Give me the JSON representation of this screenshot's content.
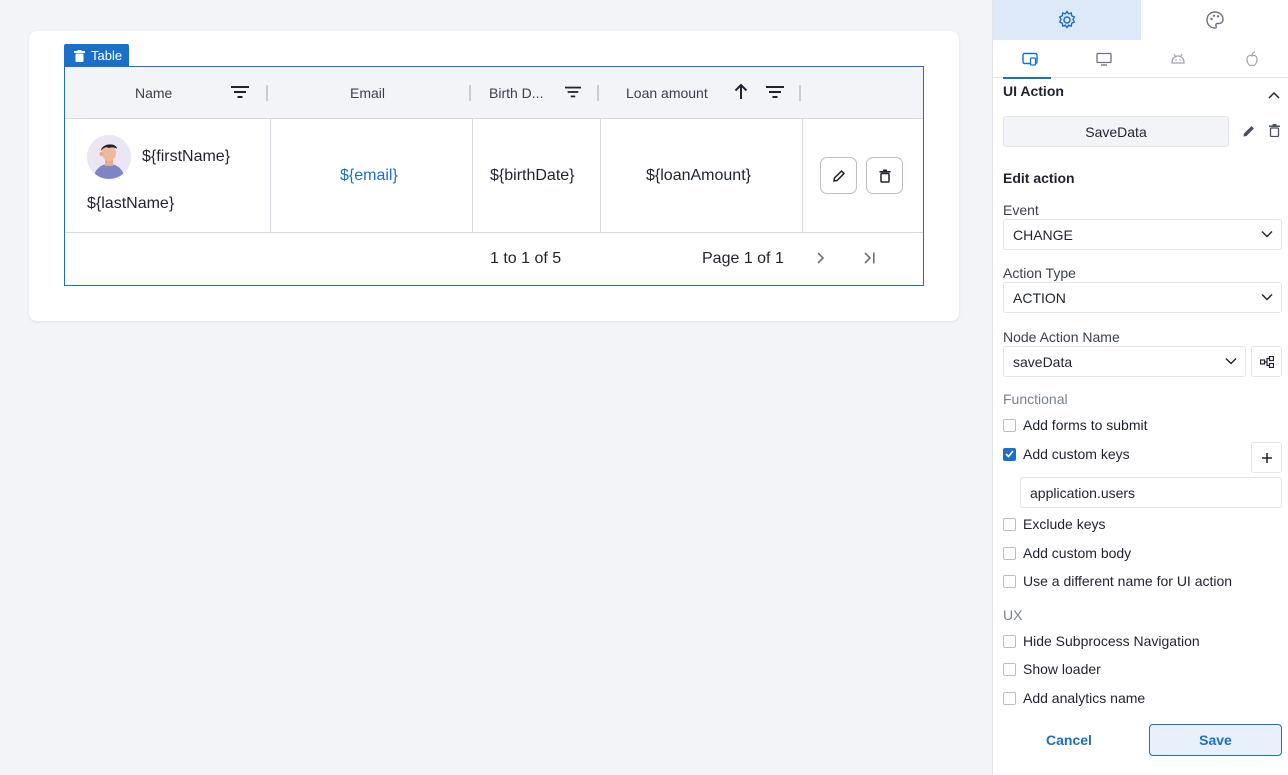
{
  "table": {
    "tag_label": "Table",
    "columns": [
      "Name",
      "Email",
      "Birth D...",
      "Loan amount"
    ],
    "row": {
      "first_name": "${firstName}",
      "last_name": "${lastName}",
      "email": "${email}",
      "birth_date": "${birthDate}",
      "loan_amount": "${loanAmount}"
    },
    "pager": {
      "range": "1 to 1 of 5",
      "page": "Page 1 of 1"
    },
    "sort_column": "Loan amount",
    "sort_direction": "ascending"
  },
  "panel": {
    "top_tabs": [
      {
        "icon": "gear-icon",
        "active": true
      },
      {
        "icon": "palette-icon",
        "active": false
      }
    ],
    "platform_tabs": [
      {
        "icon": "all-platforms-icon",
        "active": true
      },
      {
        "icon": "desktop-icon",
        "active": false
      },
      {
        "icon": "android-icon",
        "active": false
      },
      {
        "icon": "apple-icon",
        "active": false
      }
    ],
    "section_title": "UI Action",
    "action_name": "SaveData",
    "edit_action_title": "Edit action",
    "event": {
      "label": "Event",
      "value": "CHANGE"
    },
    "action_type": {
      "label": "Action Type",
      "value": "ACTION"
    },
    "node_action": {
      "label": "Node Action Name",
      "value": "saveData"
    },
    "functional_label": "Functional",
    "functional_options": [
      {
        "label": "Add forms to submit",
        "checked": false
      },
      {
        "label": "Add custom keys",
        "checked": true
      },
      {
        "label": "Exclude keys",
        "checked": false
      },
      {
        "label": "Add custom body",
        "checked": false
      },
      {
        "label": "Use a different name for UI action",
        "checked": false
      }
    ],
    "custom_key_value": "application.users",
    "ux_label": "UX",
    "ux_options": [
      {
        "label": "Hide Subprocess Navigation",
        "checked": false
      },
      {
        "label": "Show loader",
        "checked": false
      },
      {
        "label": "Add analytics name",
        "checked": false
      }
    ],
    "cancel_label": "Cancel",
    "save_label": "Save"
  },
  "colors": {
    "accent": "#1a70c8",
    "background": "#f3f4f7",
    "active_tab": "#dde9f8"
  }
}
